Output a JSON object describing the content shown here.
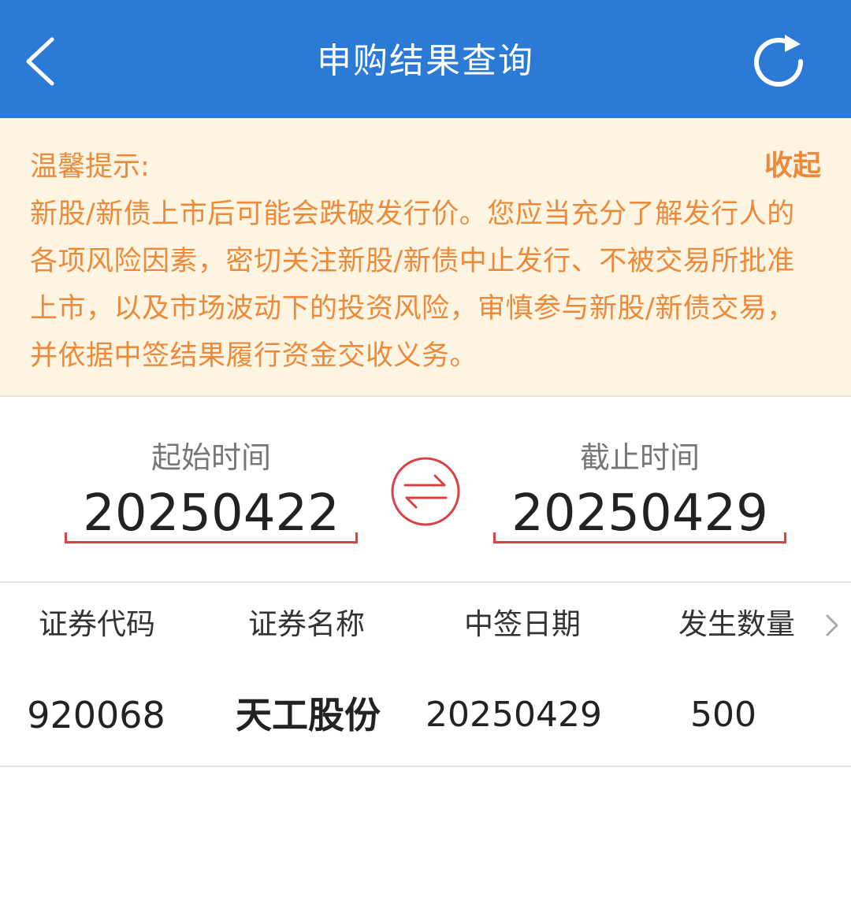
{
  "header": {
    "title": "申购结果查询",
    "back_icon": "chevron-left-icon",
    "refresh_icon": "refresh-icon"
  },
  "notice": {
    "title": "温馨提示:",
    "collapse_label": "收起",
    "body": "新股/新债上市后可能会跌破发行价。您应当充分了解发行人的各项风险因素，密切关注新股/新债中止发行、不被交易所批准上市，以及市场波动下的投资风险，审慎参与新股/新债交易，并依据中签结果履行资金交收义务。"
  },
  "date_range": {
    "start_label": "起始时间",
    "start_value": "20250422",
    "end_label": "截止时间",
    "end_value": "20250429",
    "swap_icon": "swap-arrows-icon"
  },
  "table": {
    "headers": [
      "证券代码",
      "证券名称",
      "中签日期",
      "发生数量"
    ],
    "rows": [
      [
        "920068",
        "天工股份",
        "20250429",
        "500"
      ]
    ]
  },
  "colors": {
    "header_bg": "#2a7ad6",
    "notice_bg": "#fdf4e2",
    "notice_text": "#ec8a3c",
    "accent_red": "#d84343"
  }
}
